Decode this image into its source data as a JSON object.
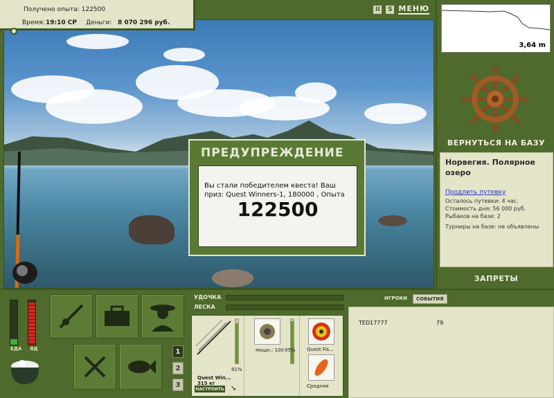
{
  "status": {
    "experience_label": "Получено опыта:",
    "experience_value": "122500",
    "time_label": "Время:",
    "time_value": "19:10 СР",
    "money_label": "Деньги:",
    "money_value": "8 070 296 руб."
  },
  "toolbar": {
    "pause_label": "II",
    "sound_label": "S",
    "menu_label": "МЕНЮ"
  },
  "depth_graph": {
    "depth_label": "3,64 m"
  },
  "sidebar": {
    "return_label": "ВЕРНУТЬСЯ НА БАЗУ",
    "location_title": "Норвегия. Полярное озеро",
    "extend_link": "Продлить путевку",
    "info_lines": [
      "Осталось путевки: 4 час.",
      "Стоимость дня: 56 000 руб.",
      "Рыбаков на базе: 2",
      "Турниры на базе: не объявлены"
    ],
    "bans_label": "ЗАПРЕТЫ"
  },
  "dialog": {
    "title": "ПРЕДУПРЕЖДЕНИЕ",
    "message": "Вы стали победителем квеста! Ваш приз: Quest Winners-1, 180000 , Опыта",
    "amount": "122500"
  },
  "meters": {
    "food_label": "ЕДА",
    "poison_label": "ЯД",
    "food_level": 0.12,
    "poison_level": 0.95
  },
  "pages": [
    "1",
    "2",
    "3"
  ],
  "tackle": {
    "rod_label": "УДОЧКА",
    "line_label": "ЛЕСКА",
    "rod_name": "Quest Win...",
    "rod_weight": "315 кг",
    "rod_percent": "91%",
    "reel_power": "мощн.: 100",
    "reel_percent": "95%",
    "line_name": "Quest Fis...",
    "lure_name": "Средняя",
    "setup_label": "НАСТРОИТЬ",
    "rod_level": 0.91,
    "reel_level": 0.95
  },
  "players": {
    "tabs": [
      "ИГРОКИ",
      "СОБЫТИЯ"
    ],
    "rows": [
      {
        "name": "TED17777",
        "value": "79"
      }
    ]
  }
}
